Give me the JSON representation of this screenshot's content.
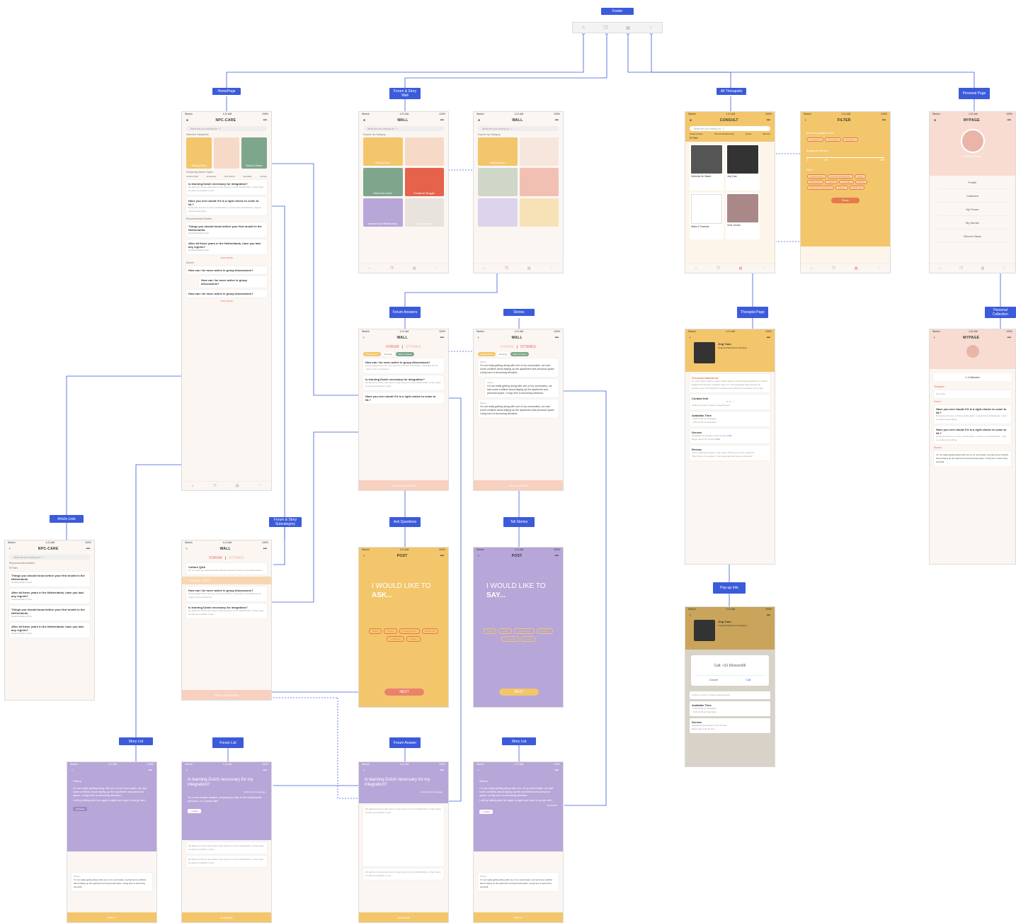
{
  "colors": {
    "accent": "#3b5bdb",
    "orange": "#f3c66b",
    "coral": "#e46a5a",
    "purple": "#b7a6d8",
    "cream": "#fbf6f2"
  },
  "tags": {
    "footer": "Footer",
    "homepage": "HomePage",
    "forum_story_wall": "Forum & Story Wall",
    "all_therapists": "All Therapists",
    "personal_page": "Personal Page",
    "forum_answers": "Forum Answers",
    "stories": "Stories",
    "therapist_page": "Therapist Page",
    "personal_collection": "Personal Collection",
    "article_lists": "Article Lists",
    "forum_story_subcategory": "Forum & Story Subcategory",
    "ask_questions": "Ask Questions",
    "tell_stories": "Tell Stories",
    "popup_info": "Pop-up Info",
    "story_list_1": "Story List",
    "forum_list": "Forum List",
    "forum_answer": "Forum Answer",
    "story_list_2": "Story List"
  },
  "status": {
    "carrier": "Sketch",
    "time": "1:21 AM",
    "battery": "100%"
  },
  "titles": {
    "npc": "NPC-CARE",
    "wall": "WALL",
    "consult": "CONSULT",
    "filter": "FILTER",
    "mypage": "MYPAGE",
    "post": "POST"
  },
  "search_placeholder": "What are you looking for...?",
  "home": {
    "selected_categories": "Selected Categories",
    "faq": "Frequently Asked Topics",
    "topics": [
      "Culture Q&A",
      "Academia",
      "First Month",
      "Sexuality",
      "Anxiety"
    ],
    "cat_tiles": [
      "Settling Down",
      "",
      "Work & Career"
    ],
    "q1": "Is learning Dutch necessary for integration?",
    "q1_body": "My advice for those who want to stay long term in the Netherlands, is that, begin as early as possible in your...",
    "q2": "Have you ever doubt if it is a right choice to come to NL?",
    "q2_body": "During the first two or three months after I moved to the Netherlands, I was so excited. Everything",
    "recommended": "Recommended Articles",
    "art1": "Things you should know before your first month in the Netherlands.",
    "art2": "After all these years in the Netherlands, have you had any regrets?",
    "source": "NewPortHolland Q&A",
    "view_more": "VIEW MORE",
    "stories": "Stories",
    "story_q": "How can I be more active in group discussions?"
  },
  "wall": {
    "explore": "Explore by Category",
    "tiles": [
      "Settling Down",
      "",
      "Work and Career",
      "Emotional Struggle",
      "Interpersonal Relationship",
      "Add Category"
    ],
    "forum": "FORUM",
    "stories_tab": "STORIES",
    "chips": [
      "Settling Down",
      "Studying",
      "Work & Career"
    ],
    "fq1": "How can I be more active in group discussions?",
    "fq1_body": "Group assignments are very common in Dutch Universities, especially for the majors such as business...",
    "fq2": "Is learning Dutch necessary for integration?",
    "fq3": "Have you ever doubt if it is a right choice to come to NL?",
    "ask_btn": "ASK A QUESTION",
    "tell_btn": "TELL A STORY",
    "s_body": "I'm not really getting along with one of my roommates, we had some conflicts about tidying up the apartment and personal space. Living here is becoming stressful...",
    "user": "Sherry"
  },
  "subcat": {
    "culture": "Culture Q&A",
    "culture_body": "Do you have any questions about Dutch cultures? Check out the Q&A session!",
    "parent": "PARENT TOPIC"
  },
  "post": {
    "ask1": "I WOULD LIKE TO",
    "ask2": "ASK...",
    "say2": "SAY...",
    "tags": [
      "Study",
      "Career",
      "Settling Down",
      "Emotional",
      "Loneliness",
      "Anxiety"
    ],
    "next": "NEXT"
  },
  "consult": {
    "filters": [
      "Social Anxiety",
      "Intimate Relationship",
      "Stress",
      "Burnout"
    ],
    "filter_label": "Filter",
    "t1": "Gertrudis De Waard",
    "t2": "Jing Yuan",
    "t3": "Wieke & Tweestar",
    "t4": "Irene Cendra"
  },
  "filterpage": {
    "location_label": "Search for location Here",
    "cities": [
      "Amsterdam",
      "The Hague",
      "Rotterdam"
    ],
    "budget": "Budget per Session",
    "budget_min": "0",
    "budget_max": "250",
    "budget_val": "80",
    "field": "Field",
    "fields": [
      "Social Anxiety",
      "Intimate Relationship",
      "Stress",
      "Depression",
      "Trauma",
      "Sexuality",
      "Identity",
      "Personal Development",
      "Career",
      "Weakness"
    ],
    "done": "Done"
  },
  "therapist": {
    "name": "Jing Yuan",
    "role": "Cognitive Behavioral Therapist",
    "statement_h": "Personal Statement",
    "statement": "Dr. Yuan Jing's practice offers a wide range of psychological assistance in Dutch, English and Chinese. Together with you I will investigate what caused the problem and I will looking for a solution that will help you achieve your goals.",
    "contact": "Contact Info",
    "contact_note": "Getting in touch to make an appointment",
    "avail": "Available Time",
    "t_week": "- 9:00-22:30 on Workdays",
    "t_sat": "- 9:00-13:30 on Saturdays",
    "service": "Service",
    "svc1": "Individual conversation of 40 minutes",
    "svc1_p": "€ 90",
    "svc2": "Skype call of 45 minutes",
    "svc2_p": "€ 90",
    "review": "Review",
    "r1": "\"From realizing to begin to ask myself. Thank you for the sessions.\"",
    "r2": "\"Miss Jing is very patient. I feel respected and being understood.\"",
    "call": "Call: +31 66xxxxx66",
    "cancel": "Cancel",
    "call_btn": "Call"
  },
  "mypage": {
    "user": "Sherry Sheng",
    "menu": [
      "Profile",
      "Collected",
      "My Forum",
      "My Stories",
      "Recent Views"
    ],
    "collected": "Collected",
    "therapist": "Therapist",
    "forum": "Forum",
    "stories": "Stories"
  },
  "articles": {
    "recommended": "Recommended Articles",
    "filter": "Filter"
  },
  "detail": {
    "q": "Is learning Dutch necessary for my integration?",
    "tags": [
      "Culture Q&A",
      "Language"
    ],
    "intro": "I'm a new master student, preparing to stay in the Netherlands perhaps 1 or 2 years after",
    "follow": "Follow",
    "followed": "Followed",
    "answer": "ANSWER",
    "reply": "REPLY",
    "story": "I'm not really getting along with one of my roommates, we had some conflicts about tidying up the apartment and personal space. Living here is becoming stressful...",
    "story2": "I will try talking with her again tonight and hope it can go well...",
    "date": "12/04/2019"
  }
}
